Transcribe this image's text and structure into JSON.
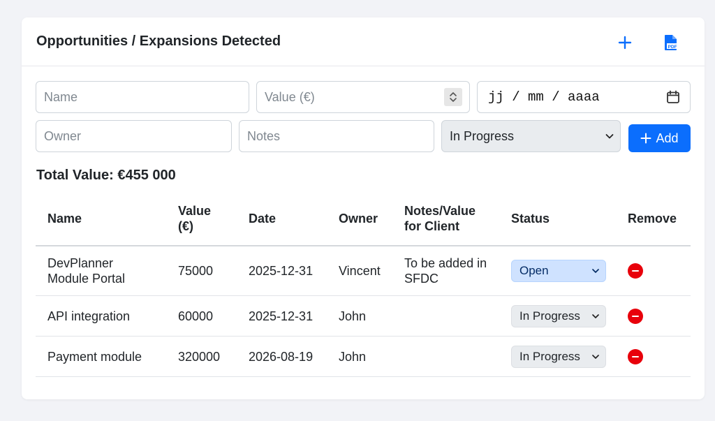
{
  "card": {
    "title": "Opportunities / Expansions Detected",
    "add_icon": "plus-icon",
    "pdf_icon": "pdf-file-icon",
    "pdf_icon_text": "PDF",
    "accent_color": "#0b6efd"
  },
  "form": {
    "name_placeholder": "Name",
    "value_placeholder": "Value (€)",
    "date_value": "jj / mm / aaaa",
    "owner_placeholder": "Owner",
    "notes_placeholder": "Notes",
    "status_selected": "In Progress",
    "add_label": "Add"
  },
  "total_label": "Total Value: €455 000",
  "table": {
    "headers": {
      "name": "Name",
      "value": "Value (€)",
      "date": "Date",
      "owner": "Owner",
      "notes": "Notes/Value for Client",
      "status": "Status",
      "remove": "Remove"
    },
    "rows": [
      {
        "name": "DevPlanner Module Portal",
        "value": "75000",
        "date": "2025-12-31",
        "owner": "Vincent",
        "notes": "To be added in SFDC",
        "status": "Open"
      },
      {
        "name": "API integration",
        "value": "60000",
        "date": "2025-12-31",
        "owner": "John",
        "notes": "",
        "status": "In Progress"
      },
      {
        "name": "Payment module",
        "value": "320000",
        "date": "2026-08-19",
        "owner": "John",
        "notes": "",
        "status": "In Progress"
      }
    ]
  },
  "colors": {
    "open_status_bg": "#cfe2ff",
    "remove_red": "#e8000b"
  }
}
